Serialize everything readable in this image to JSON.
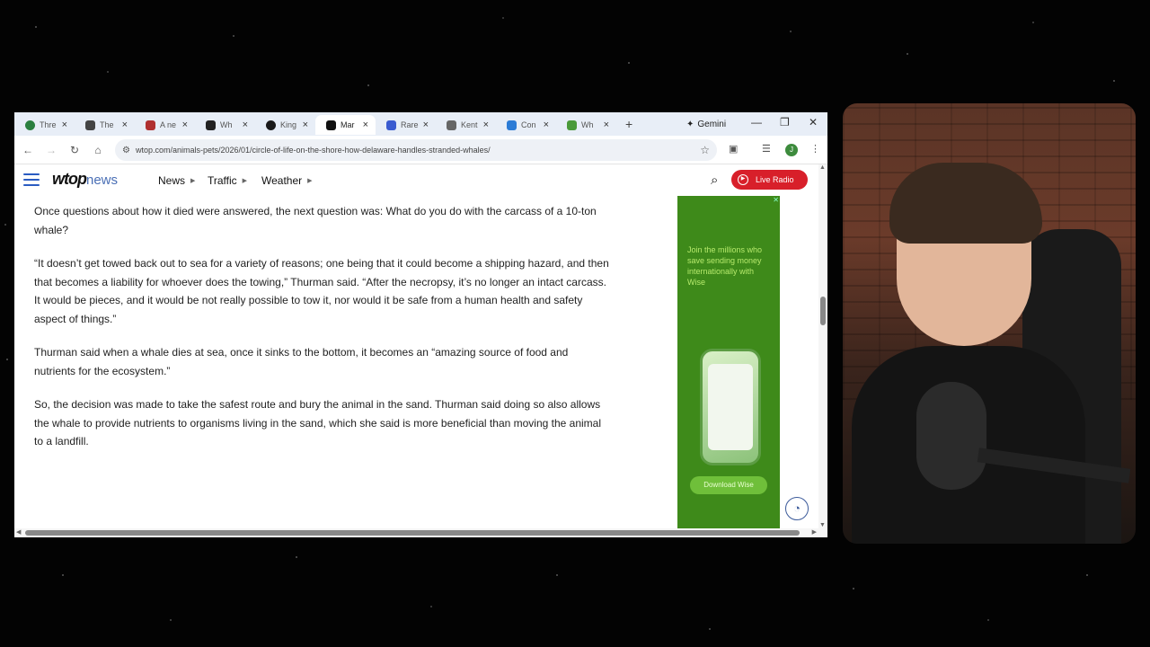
{
  "browser": {
    "tabs": [
      {
        "label": "Thre",
        "favicon_color": "#2a7f3f",
        "active": false
      },
      {
        "label": "The",
        "favicon_color": "#444444",
        "active": false
      },
      {
        "label": "A ne",
        "favicon_color": "#b03030",
        "active": false
      },
      {
        "label": "Wh",
        "favicon_color": "#222222",
        "active": false
      },
      {
        "label": "King",
        "favicon_color": "#1a1a1a",
        "active": false
      },
      {
        "label": "Mar",
        "favicon_color": "#111111",
        "active": true
      },
      {
        "label": "Rare",
        "favicon_color": "#3a5bd0",
        "active": false
      },
      {
        "label": "Kent",
        "favicon_color": "#666666",
        "active": false
      },
      {
        "label": "Con",
        "favicon_color": "#2b7bd6",
        "active": false
      },
      {
        "label": "Wh",
        "favicon_color": "#4a9a3a",
        "active": false
      }
    ],
    "gemini_label": "Gemini",
    "url": "wtop.com/animals-pets/2026/01/circle-of-life-on-the-shore-how-delaware-handles-stranded-whales/",
    "profile_initial": "J"
  },
  "site": {
    "logo_main": "wtop",
    "logo_sub": "news",
    "nav": [
      "News",
      "Traffic",
      "Weather"
    ],
    "live_radio": "Live Radio",
    "brand_color": "#d81f2a"
  },
  "article": {
    "paragraphs": [
      "Once questions about how it died were answered, the next question was: What do you do with the carcass of a 10-ton whale?",
      "“It doesn’t get towed back out to sea for a variety of reasons; one being that it could become a shipping hazard, and then that becomes a liability for whoever does the towing,” Thurman said. “After the necropsy, it’s no longer an intact carcass. It would be pieces, and it would be not really possible to tow it, nor would it be safe from a human health and safety aspect of things.”",
      "Thurman said when a whale dies at sea, once it sinks to the bottom, it becomes an “amazing source of food and nutrients for the ecosystem.”",
      "So, the decision was made to take the safest route and bury the animal in the sand. Thurman said doing so also allows the whale to provide nutrients to organisms living in the sand, which she said is more beneficial than moving the animal to a landfill."
    ]
  },
  "ad": {
    "text": "Join the millions who save sending money internationally with Wise",
    "button": "Download Wise",
    "color": "#3e8a1a"
  }
}
